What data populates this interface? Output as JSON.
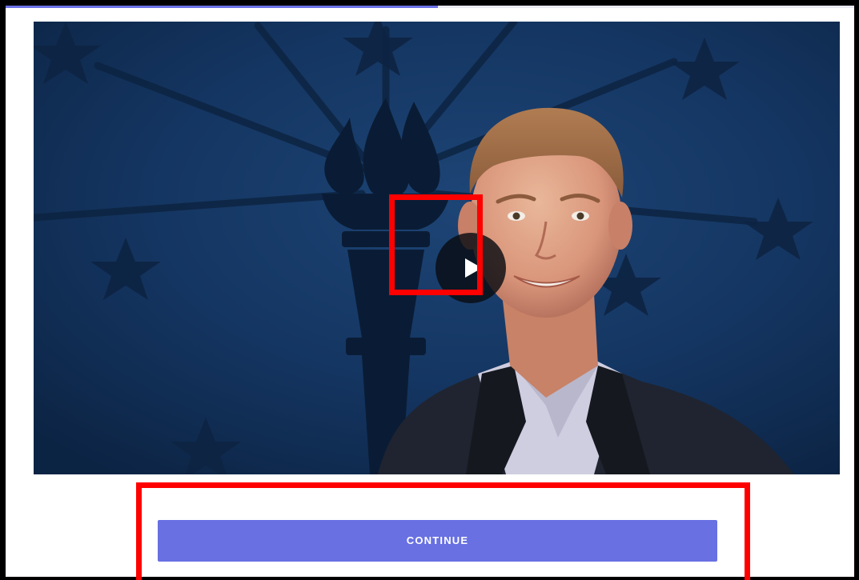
{
  "video": {
    "play_icon": "play-icon",
    "background_colors": {
      "flag_blue": "#123056",
      "torch_dark": "#0a1c35"
    }
  },
  "actions": {
    "continue_label": "CONTINUE"
  },
  "colors": {
    "accent": "#6870e2",
    "highlight": "#ff0000"
  }
}
